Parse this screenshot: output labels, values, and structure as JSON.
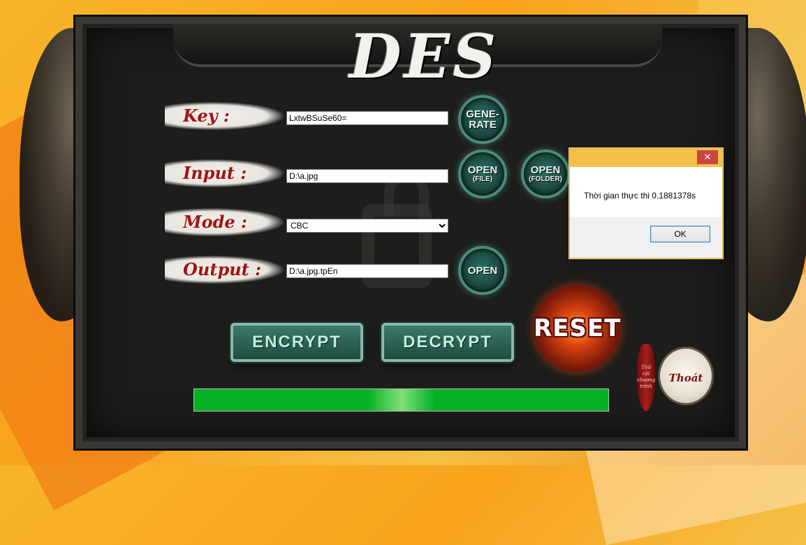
{
  "app": {
    "title": "DES"
  },
  "labels": {
    "key": "Key :",
    "input": "Input :",
    "mode": "Mode :",
    "output": "Output :"
  },
  "fields": {
    "key_value": "LxtwBSuSe60=",
    "input_value": "D:\\a.jpg",
    "mode_selected": "CBC",
    "output_value": "D:\\a.jpg.tpEn"
  },
  "buttons": {
    "generate_line1": "GENE-",
    "generate_line2": "RATE",
    "open_file_line1": "OPEN",
    "open_file_line2": "(FILE)",
    "open_folder_line1": "OPEN",
    "open_folder_line2": "(FOLDER)",
    "open_output": "OPEN",
    "encrypt": "ENCRYPT",
    "decrypt": "DECRYPT",
    "reset": "RESET",
    "exit": "Thoát"
  },
  "scroll": {
    "text": "Thử cái chương trình"
  },
  "progress": {
    "value": 1.0
  },
  "dialog": {
    "close_glyph": "✕",
    "message": "Thời gian thực thi 0.1881378s",
    "ok_label": "OK"
  },
  "colors": {
    "progress_green": "#06b025",
    "dialog_title": "#f5c04a",
    "label_red": "#a11414"
  }
}
